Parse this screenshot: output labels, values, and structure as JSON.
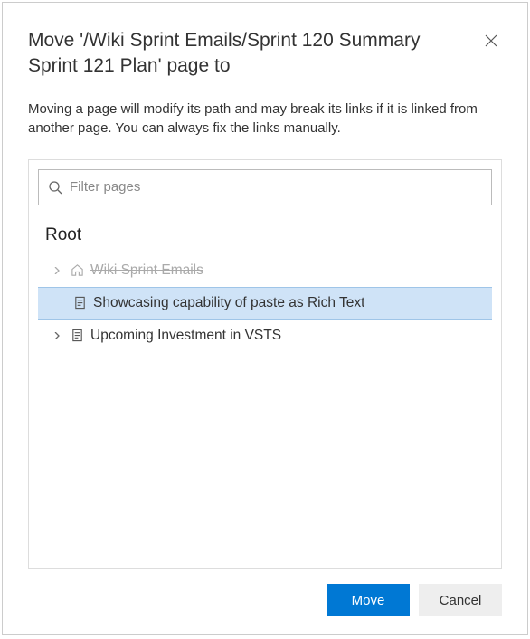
{
  "dialog": {
    "title": "Move '/Wiki Sprint Emails/Sprint 120 Summary Sprint 121 Plan' page to",
    "description": "Moving a page will modify its path and may break its links if it is linked from another page. You can always fix the links manually."
  },
  "filter": {
    "placeholder": "Filter pages"
  },
  "tree": {
    "root_label": "Root",
    "items": [
      {
        "label": "Wiki Sprint Emails",
        "expandable": true,
        "disabled": true,
        "icon": "home"
      },
      {
        "label": "Showcasing capability of paste as Rich Text",
        "expandable": false,
        "selected": true,
        "icon": "page"
      },
      {
        "label": "Upcoming Investment in VSTS",
        "expandable": true,
        "icon": "page"
      }
    ]
  },
  "buttons": {
    "primary": "Move",
    "secondary": "Cancel"
  }
}
